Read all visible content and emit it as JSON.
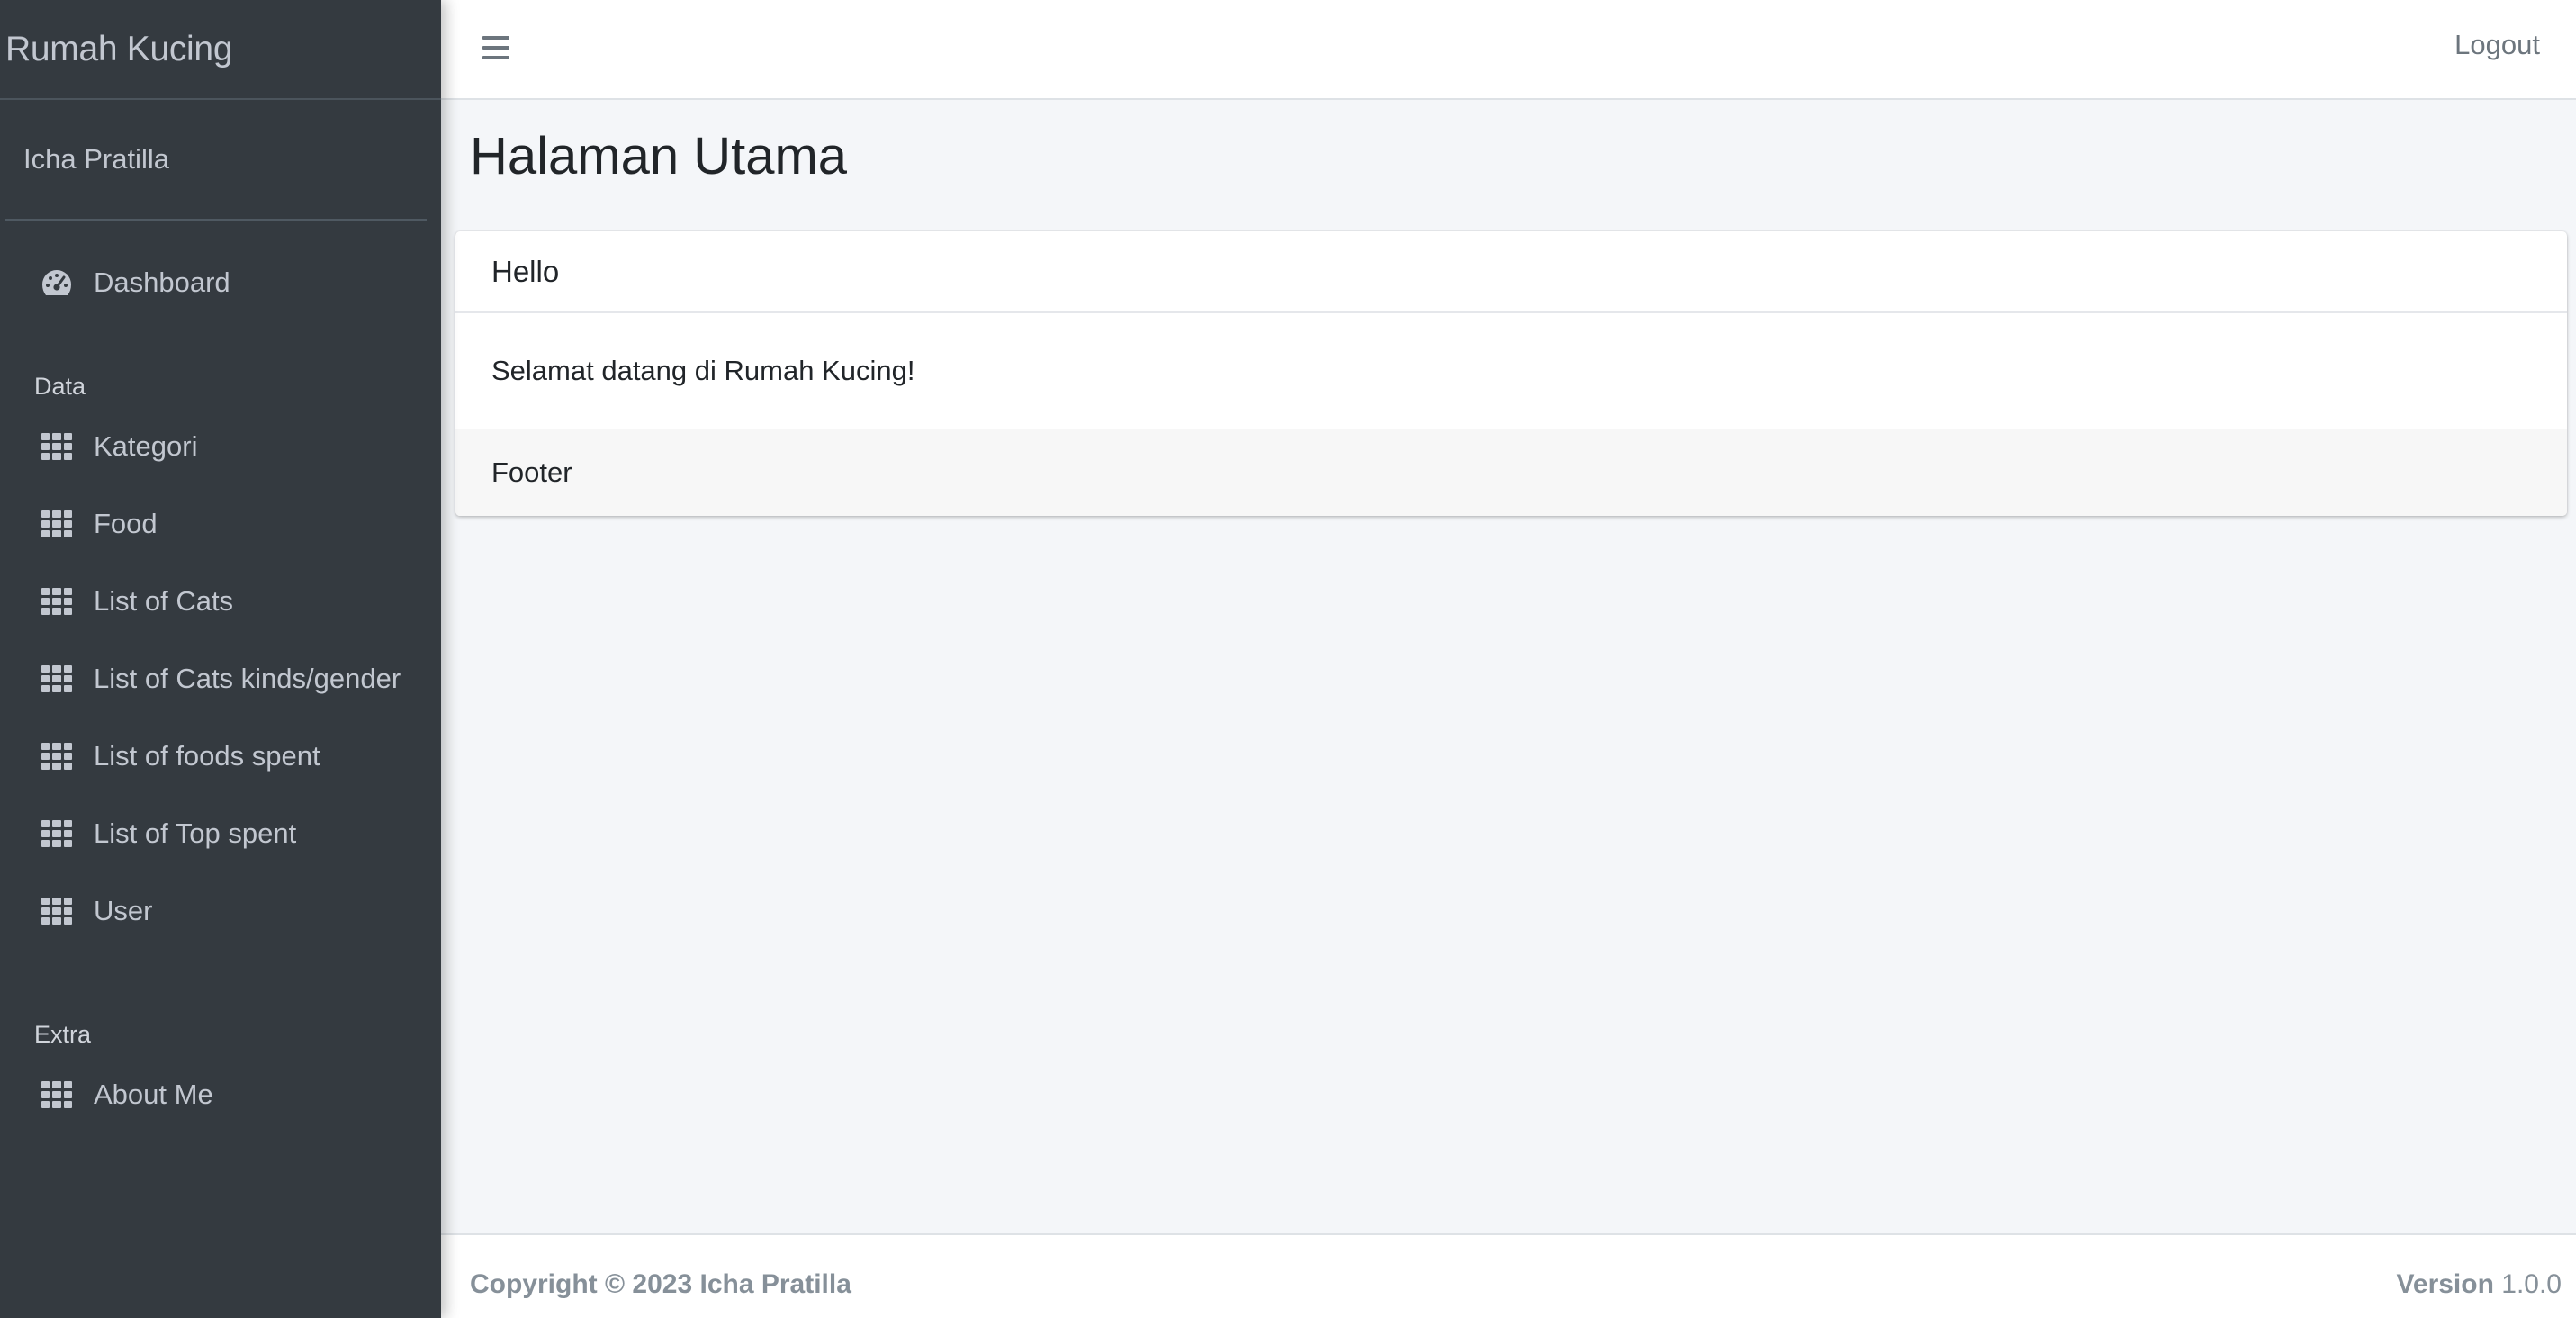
{
  "brand": {
    "title": "Rumah Kucing"
  },
  "user": {
    "name": "Icha Pratilla"
  },
  "sidebar": {
    "dashboard": {
      "label": "Dashboard",
      "icon": "tachometer-icon"
    },
    "header_data": "Data",
    "items": [
      {
        "label": "Kategori",
        "icon": "grid-icon"
      },
      {
        "label": "Food",
        "icon": "grid-icon"
      },
      {
        "label": "List of Cats",
        "icon": "grid-icon"
      },
      {
        "label": "List of Cats kinds/gender",
        "icon": "grid-icon"
      },
      {
        "label": "List of foods spent",
        "icon": "grid-icon"
      },
      {
        "label": "List of Top spent",
        "icon": "grid-icon"
      },
      {
        "label": "User",
        "icon": "grid-icon"
      }
    ],
    "header_extra": "Extra",
    "extra_items": [
      {
        "label": "About Me",
        "icon": "grid-icon"
      }
    ]
  },
  "topbar": {
    "menu_icon": "hamburger-icon",
    "logout_label": "Logout"
  },
  "page": {
    "title": "Halaman Utama"
  },
  "card": {
    "header": "Hello",
    "body": "Selamat datang di Rumah Kucing!",
    "footer": "Footer"
  },
  "footer": {
    "copyright": "Copyright © 2023 Icha Pratilla",
    "version_label": "Version",
    "version_number": "1.0.0"
  },
  "colors": {
    "sidebar_bg": "#343a40",
    "sidebar_text": "#c2c7d0",
    "content_bg": "#f4f6f9",
    "footer_text": "#869099"
  }
}
